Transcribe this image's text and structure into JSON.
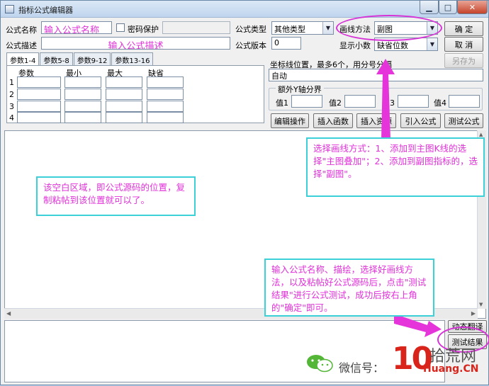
{
  "window": {
    "title": "指标公式编辑器",
    "btn_min": "▁",
    "btn_max": "□",
    "btn_close": "✕"
  },
  "form": {
    "name_label": "公式名称",
    "name_value": "输入公式名称",
    "password_label": "密码保护",
    "desc_label": "公式描述",
    "desc_value": "输入公式描述",
    "type_label": "公式类型",
    "type_value": "其他类型",
    "version_label": "公式版本",
    "version_value": "0",
    "draw_label": "画线方法",
    "draw_value": "副图",
    "decimal_label": "显示小数",
    "decimal_value": "缺省位数",
    "coord_label": "坐标线位置，最多6个，用分号分隔",
    "coord_value": "自动",
    "extra_y_label": "额外Y轴分界",
    "val1_label": "值1",
    "val2_label": "值2",
    "val3_label": "值3",
    "val4_label": "值4"
  },
  "buttons": {
    "ok": "确  定",
    "cancel": "取  消",
    "save_as": "另存为",
    "edit_ops": "编辑操作",
    "insert_func": "插入函数",
    "insert_res": "插入资源",
    "import_formula": "引入公式",
    "test_formula": "测试公式",
    "dynamic_translate": "动态翻译",
    "test_result": "测试结果"
  },
  "tabs": [
    "参数1-4",
    "参数5-8",
    "参数9-12",
    "参数13-16"
  ],
  "params": {
    "headers": [
      "参数",
      "最小",
      "最大",
      "缺省"
    ],
    "rows": [
      "1",
      "2",
      "3",
      "4"
    ]
  },
  "annotations": {
    "draw_method": "选择画线方式：1、添加到主图K线的选择\"主图叠加\"；2、添加到副图指标的，选择\"副图\"。",
    "editor_area": "该空白区域，即公式源码的位置，复制粘帖到该位置就可以了。",
    "steps": "输入公式名称、描绘，选择好画线方法，以及粘帖好公式源码后，点击\"测试结果\"进行公式测试，成功后按右上角的\"确定\"即可。"
  },
  "watermark": {
    "wechat_label": "微信号：",
    "logo_number": "10",
    "logo_cn": "拾荒网",
    "logo_en": "Huang.CN"
  },
  "colors": {
    "annotation_text": "#e030d8",
    "annotation_border": "#3cd1d9",
    "logo_red": "#d9241b"
  }
}
